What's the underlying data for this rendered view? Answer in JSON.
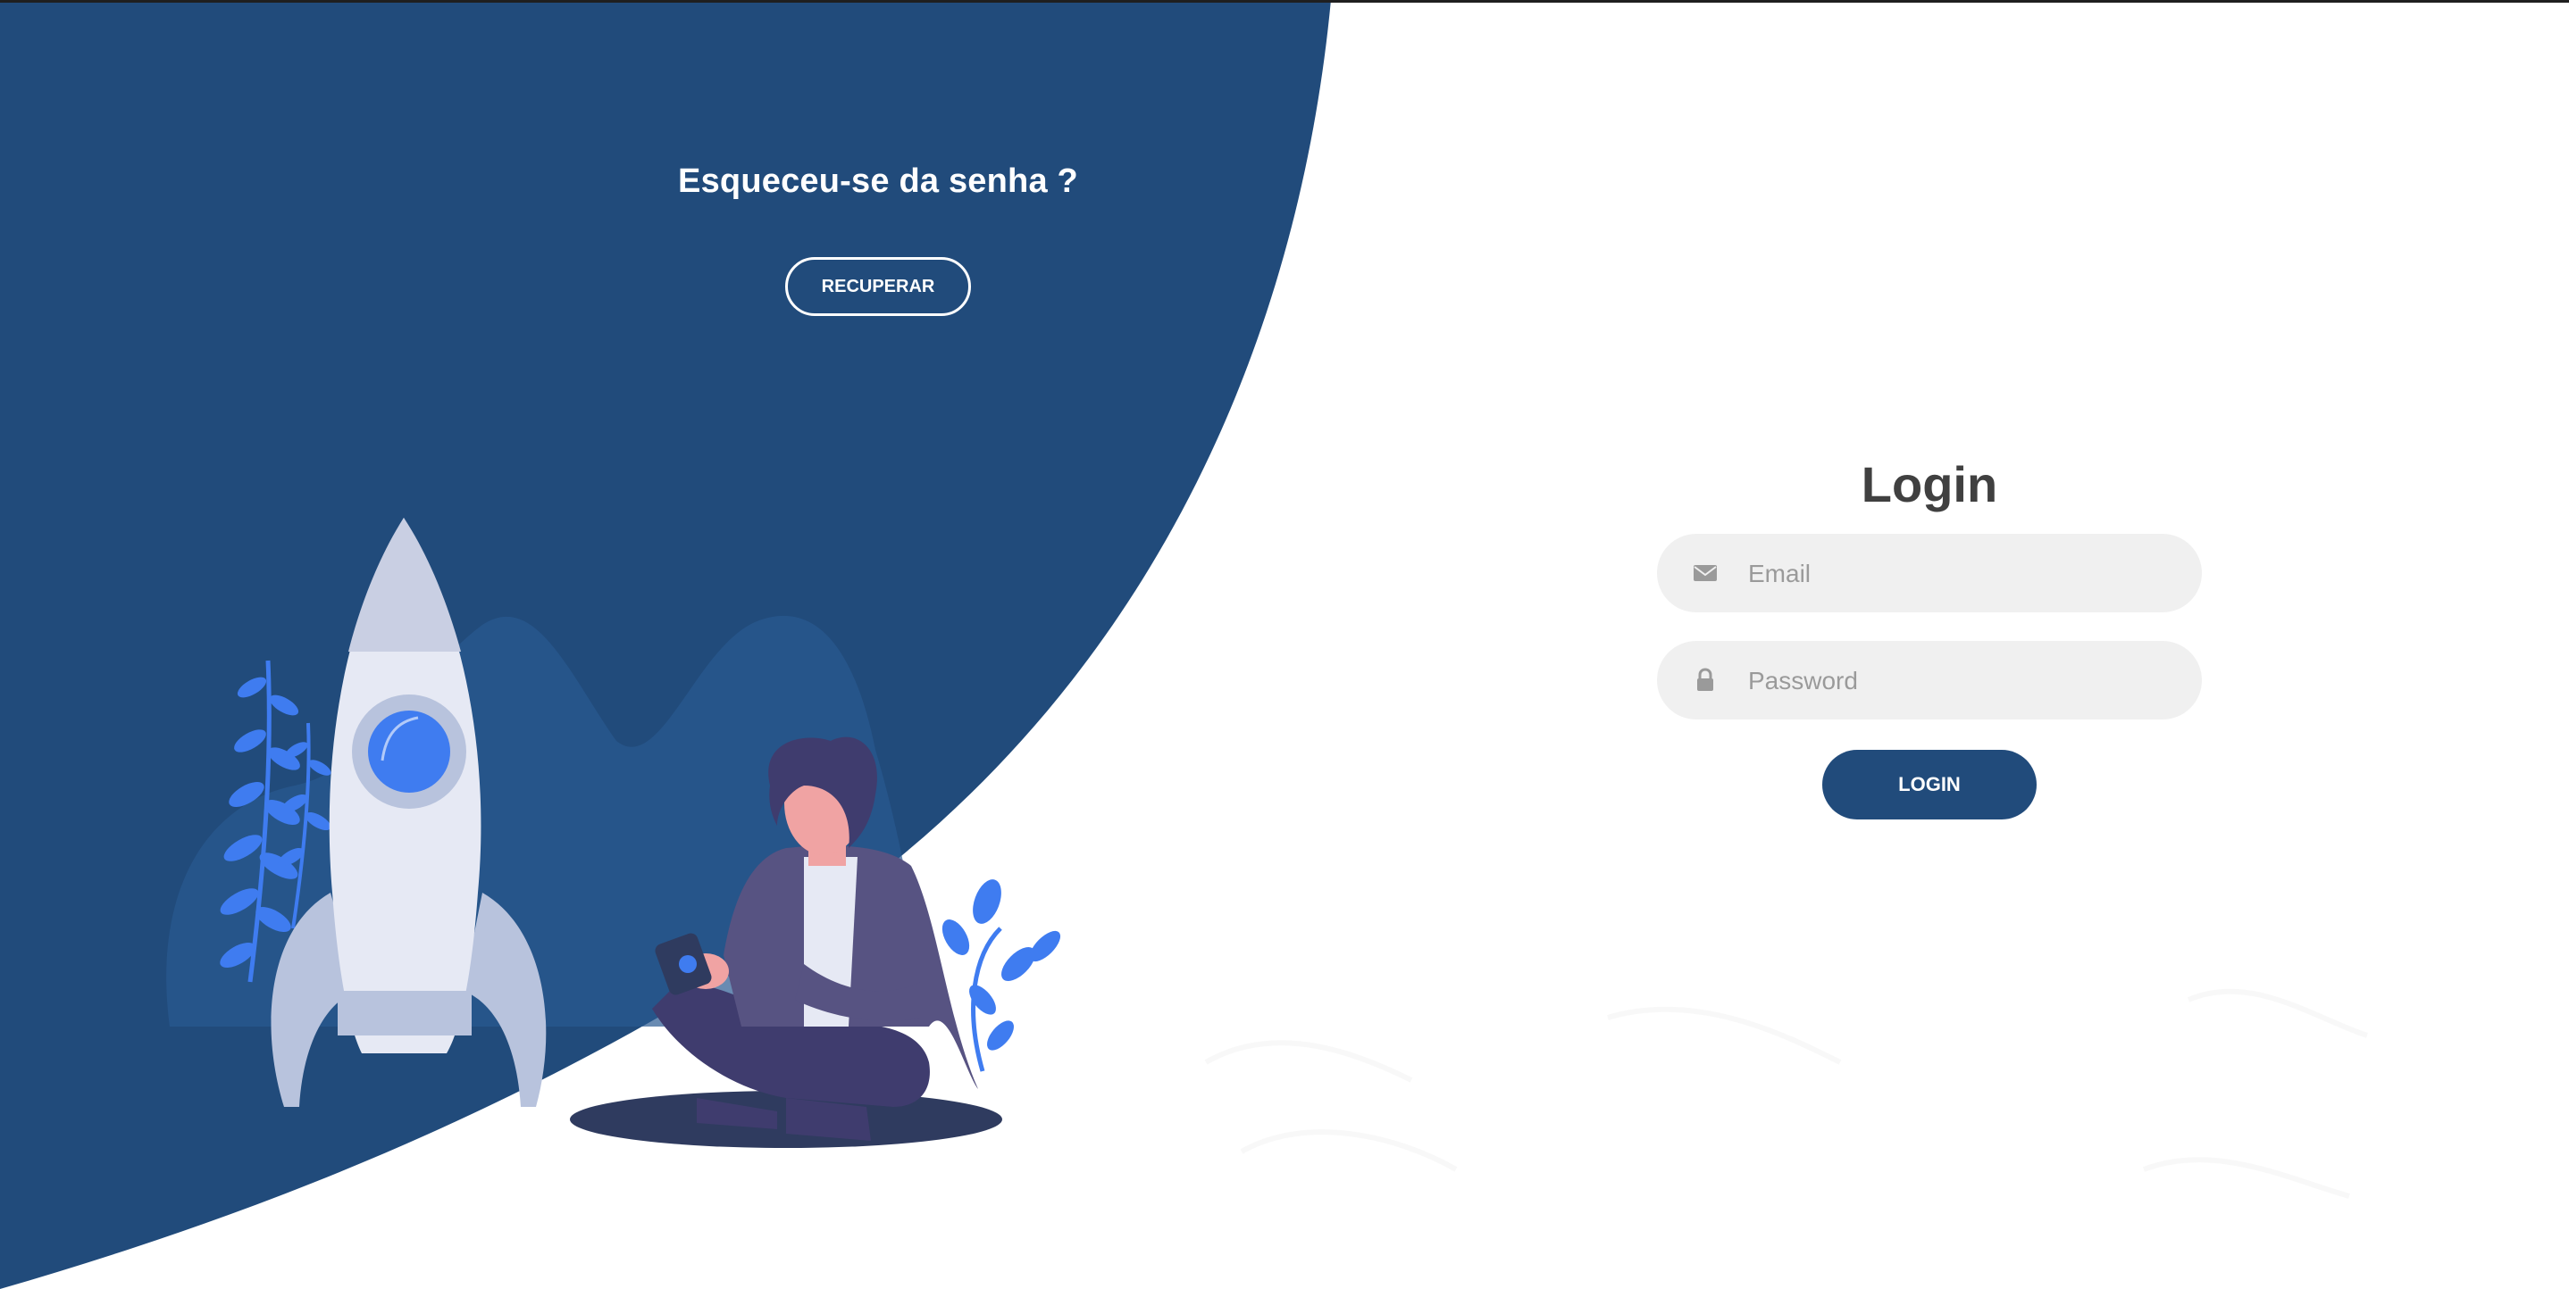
{
  "forgot": {
    "title": "Esqueceu-se da senha ?",
    "button_label": "RECUPERAR"
  },
  "login": {
    "title": "Login",
    "email_placeholder": "Email",
    "email_value": "",
    "password_placeholder": "Password",
    "password_value": "",
    "button_label": "LOGIN"
  },
  "icons": {
    "email": "envelope-icon",
    "password": "lock-icon"
  },
  "colors": {
    "primary": "#214b7b",
    "field_bg": "#f0f0f0",
    "title_text": "#404040",
    "placeholder": "#9a9a9a",
    "accent_blue": "#3f7cf0"
  }
}
